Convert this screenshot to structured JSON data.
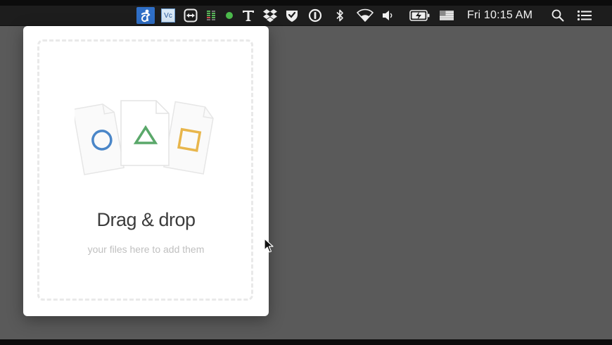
{
  "menubar": {
    "status_icons": [
      "accessibility-app-icon",
      "vc-app-icon",
      "teamviewer-icon",
      "activity-monitor-icon",
      "status-dot-icon",
      "typeface-t-icon",
      "dropbox-icon",
      "shield-check-icon",
      "power-ring-icon",
      "bluetooth-icon",
      "wifi-icon",
      "volume-icon",
      "battery-charging-icon",
      "us-flag-input-icon",
      "spotlight-search-icon",
      "notification-center-icon"
    ],
    "vc_label": "Vc",
    "clock": "Fri 10:15 AM"
  },
  "dropzone": {
    "title": "Drag & drop",
    "subtitle": "your files here to add them",
    "shape_colors": {
      "circle": "#4a86c8",
      "triangle": "#5aa86a",
      "square": "#e8b64c"
    }
  },
  "colors": {
    "desktop": "#5a5a5a",
    "menubar": "#1d1d1d",
    "accent_highlight": "#2f6fc7"
  }
}
